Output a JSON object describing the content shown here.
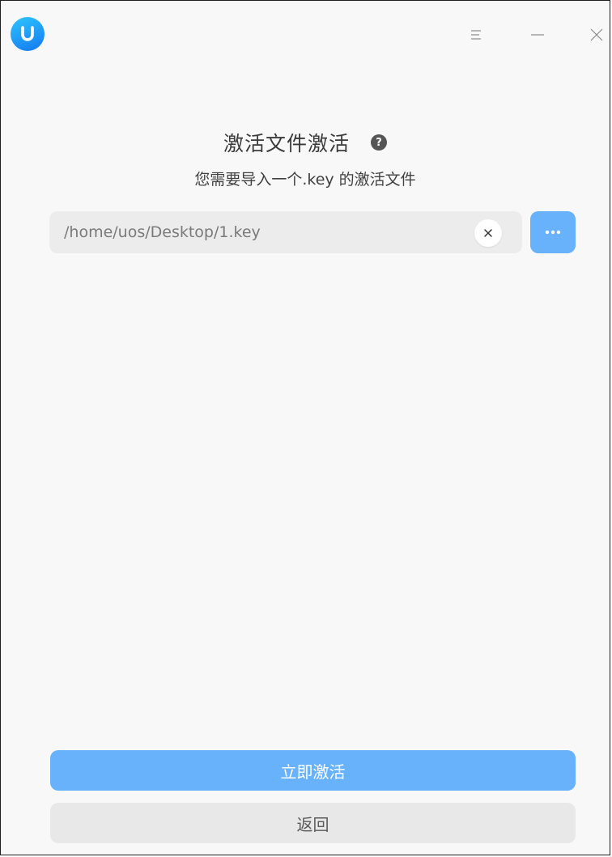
{
  "titlebar": {
    "logo_icon": "uos-logo-icon",
    "menu_icon": "hamburger-menu-icon",
    "minimize_icon": "minimize-icon",
    "close_icon": "close-icon"
  },
  "main": {
    "title": "激活文件激活",
    "help_symbol": "?",
    "subtitle": "您需要导入一个.key 的激活文件",
    "file_path": "/home/uos/Desktop/1.key",
    "clear_icon": "clear-icon",
    "browse_icon": "more-dots-icon"
  },
  "actions": {
    "activate_label": "立即激活",
    "back_label": "返回"
  },
  "colors": {
    "accent": "#67b2fb",
    "input_bg": "#ececec",
    "window_bg": "#f8f8f8"
  }
}
